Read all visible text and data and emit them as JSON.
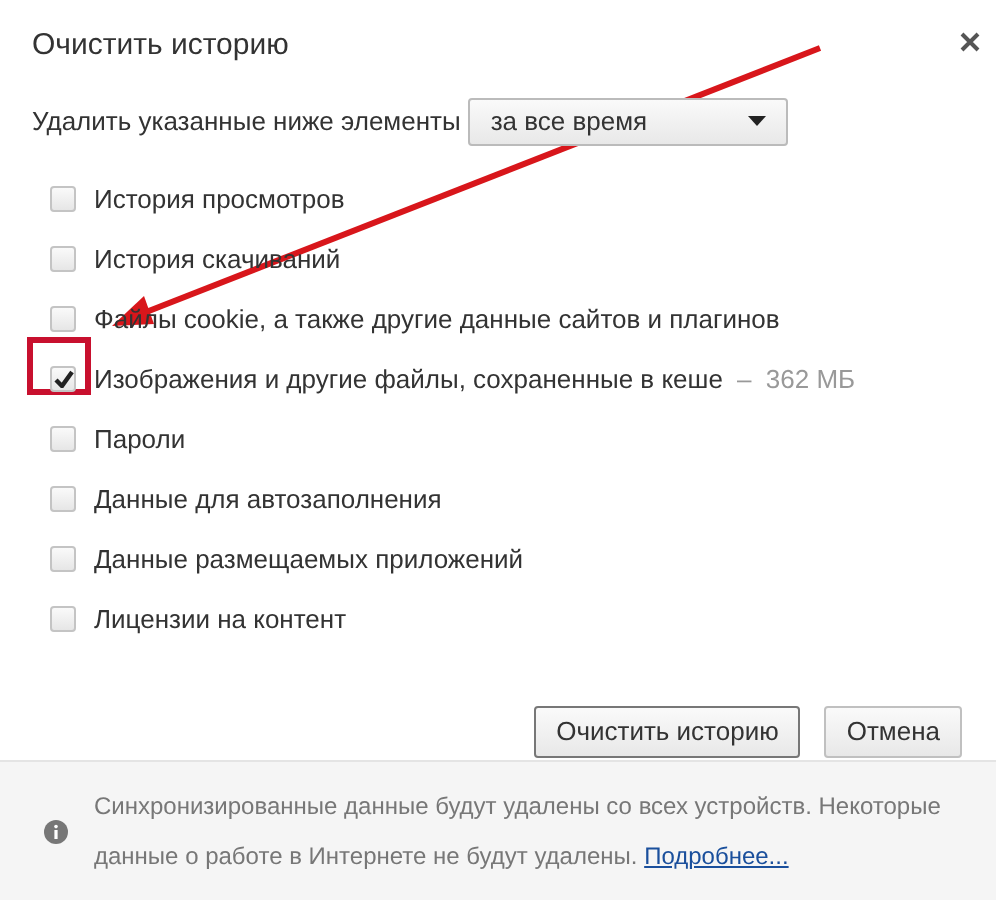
{
  "dialog": {
    "title": "Очистить историю"
  },
  "range": {
    "label": "Удалить указанные ниже элементы",
    "value": "за все время"
  },
  "items": [
    {
      "label": "История просмотров",
      "checked": false
    },
    {
      "label": "История скачиваний",
      "checked": false
    },
    {
      "label": "Файлы cookie, а также другие данные сайтов и плагинов",
      "checked": false
    },
    {
      "label": "Изображения и другие файлы, сохраненные в кеше",
      "detail": "–  362 МБ",
      "checked": true
    },
    {
      "label": "Пароли",
      "checked": false
    },
    {
      "label": "Данные для автозаполнения",
      "checked": false
    },
    {
      "label": "Данные размещаемых приложений",
      "checked": false
    },
    {
      "label": "Лицензии на контент",
      "checked": false
    }
  ],
  "buttons": [
    {
      "label": "Очистить историю",
      "kind": "primary"
    },
    {
      "label": "Отмена",
      "kind": "secondary"
    }
  ],
  "notice": {
    "text": "Синхронизированные данные будут удалены со всех устройств. Некоторые данные о работе в Интернете не будут удалены.",
    "link": "Подробнее..."
  }
}
